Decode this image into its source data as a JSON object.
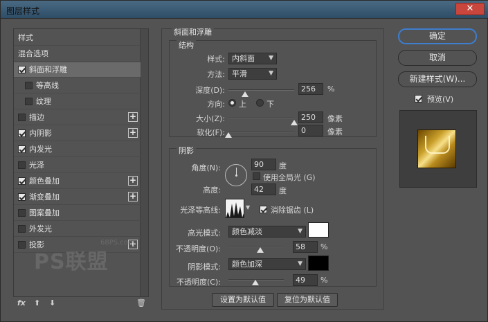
{
  "window": {
    "title": "图层样式",
    "close_glyph": "✕"
  },
  "style_list": {
    "items": [
      {
        "label": "样式",
        "has_checkbox": false,
        "checked": false,
        "has_plus": false,
        "active": false,
        "indent": false
      },
      {
        "label": "混合选项",
        "has_checkbox": false,
        "checked": false,
        "has_plus": false,
        "active": false,
        "indent": false
      },
      {
        "label": "斜面和浮雕",
        "has_checkbox": true,
        "checked": true,
        "has_plus": false,
        "active": true,
        "indent": false
      },
      {
        "label": "等高线",
        "has_checkbox": true,
        "checked": false,
        "has_plus": false,
        "active": false,
        "indent": true
      },
      {
        "label": "纹理",
        "has_checkbox": true,
        "checked": false,
        "has_plus": false,
        "active": false,
        "indent": true
      },
      {
        "label": "描边",
        "has_checkbox": true,
        "checked": false,
        "has_plus": true,
        "active": false,
        "indent": false
      },
      {
        "label": "内阴影",
        "has_checkbox": true,
        "checked": true,
        "has_plus": true,
        "active": false,
        "indent": false
      },
      {
        "label": "内发光",
        "has_checkbox": true,
        "checked": true,
        "has_plus": false,
        "active": false,
        "indent": false
      },
      {
        "label": "光泽",
        "has_checkbox": true,
        "checked": false,
        "has_plus": false,
        "active": false,
        "indent": false
      },
      {
        "label": "颜色叠加",
        "has_checkbox": true,
        "checked": true,
        "has_plus": true,
        "active": false,
        "indent": false
      },
      {
        "label": "渐变叠加",
        "has_checkbox": true,
        "checked": true,
        "has_plus": true,
        "active": false,
        "indent": false
      },
      {
        "label": "图案叠加",
        "has_checkbox": true,
        "checked": false,
        "has_plus": false,
        "active": false,
        "indent": false
      },
      {
        "label": "外发光",
        "has_checkbox": true,
        "checked": false,
        "has_plus": false,
        "active": false,
        "indent": false
      },
      {
        "label": "投影",
        "has_checkbox": true,
        "checked": false,
        "has_plus": true,
        "active": false,
        "indent": false
      }
    ],
    "footer": {
      "fx": "fx",
      "up": "⬆",
      "down": "⬇",
      "trash": "🗑"
    }
  },
  "bevel": {
    "section_title": "斜面和浮雕",
    "structure": {
      "title": "结构",
      "style_label": "样式:",
      "style_value": "内斜面",
      "method_label": "方法:",
      "method_value": "平滑",
      "depth_label": "深度(D):",
      "depth_value": "256",
      "depth_unit": "%",
      "depth_level": 0.25,
      "direction_label": "方向:",
      "direction_up": "上",
      "direction_down": "下",
      "direction_selected": "上",
      "size_label": "大小(Z):",
      "size_value": "250",
      "size_unit": "像素",
      "size_level": 1.0,
      "soften_label": "软化(F):",
      "soften_value": "0",
      "soften_unit": "像素",
      "soften_level": 0.0
    },
    "shading": {
      "title": "阴影",
      "angle_label": "角度(N):",
      "angle_value": "90",
      "angle_unit": "度",
      "global_light_label": "使用全局光 (G)",
      "global_light_checked": false,
      "altitude_label": "高度:",
      "altitude_value": "42",
      "altitude_unit": "度",
      "gloss_contour_label": "光泽等高线:",
      "anti_alias_label": "消除锯齿 (L)",
      "anti_alias_checked": true,
      "highlight_mode_label": "高光模式:",
      "highlight_mode_value": "颜色减淡",
      "highlight_color": "#ffffff",
      "highlight_opacity_label": "不透明度(O):",
      "highlight_opacity_value": "58",
      "highlight_opacity_unit": "%",
      "highlight_opacity_level": 0.58,
      "shadow_mode_label": "阴影模式:",
      "shadow_mode_value": "颜色加深",
      "shadow_color": "#000000",
      "shadow_opacity_label": "不透明度(C):",
      "shadow_opacity_value": "49",
      "shadow_opacity_unit": "%",
      "shadow_opacity_level": 0.49
    },
    "buttons": {
      "set_default": "设置为默认值",
      "reset_default": "复位为默认值"
    }
  },
  "side": {
    "ok": "确定",
    "cancel": "取消",
    "new_style": "新建样式(W)...",
    "preview_label": "预览(V)",
    "preview_checked": true
  },
  "watermark": {
    "brand": "PS联盟",
    "site": "68PS.com"
  }
}
